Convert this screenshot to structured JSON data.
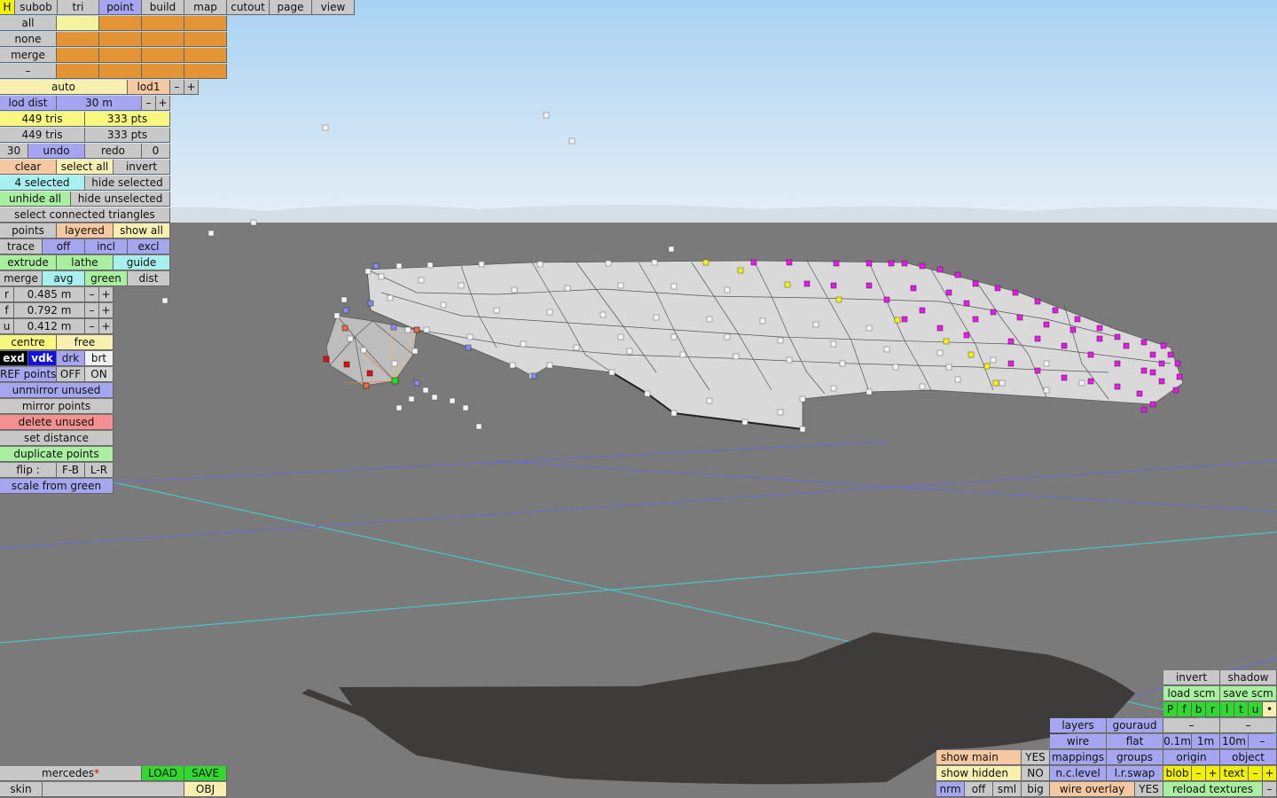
{
  "menu": {
    "h": "H",
    "tabs": [
      "subob",
      "tri",
      "point",
      "build",
      "map",
      "cutout",
      "page",
      "view"
    ],
    "active_tab": "point"
  },
  "select": {
    "all": "all",
    "none": "none",
    "merge": "merge",
    "minus": "–"
  },
  "lod": {
    "auto": "auto",
    "level": "lod1",
    "minus": "–",
    "plus": "+",
    "dist_label": "lod dist",
    "dist_value": "30 m",
    "tris1": "449 tris",
    "pts1": "333 pts",
    "tris2": "449 tris",
    "pts2": "333 pts"
  },
  "undo": {
    "count": "30",
    "undo": "undo",
    "redo": "redo",
    "redo_count": "0"
  },
  "selection": {
    "clear": "clear",
    "select_all": "select all",
    "invert": "invert",
    "selected": "4 selected",
    "hide_selected": "hide selected",
    "unhide_all": "unhide all",
    "hide_unselected": "hide unselected",
    "connected": "select connected triangles"
  },
  "mode": {
    "points": "points",
    "layered": "layered",
    "show_all": "show all"
  },
  "trace": {
    "trace": "trace",
    "off": "off",
    "incl": "incl",
    "excl": "excl"
  },
  "tools": {
    "extrude": "extrude",
    "lathe": "lathe",
    "guide": "guide",
    "merge": "merge",
    "avg": "avg",
    "green": "green",
    "dist": "dist"
  },
  "values": {
    "r_label": "r",
    "r_value": "0.485 m",
    "f_label": "f",
    "f_value": "0.792 m",
    "u_label": "u",
    "u_value": "0.412 m",
    "minus": "–",
    "plus": "+"
  },
  "pivot": {
    "centre": "centre",
    "free": "free"
  },
  "render_mode": {
    "exd": "exd",
    "vdk": "vdk",
    "drk": "drk",
    "brt": "brt"
  },
  "ref": {
    "label": "REF points",
    "off": "OFF",
    "on": "ON"
  },
  "actions": {
    "unmirror": "unmirror unused",
    "mirror": "mirror points",
    "delete": "delete unused",
    "set_distance": "set distance",
    "duplicate": "duplicate points",
    "flip": "flip :",
    "fb": "F-B",
    "lr": "L-R",
    "scale": "scale from green"
  },
  "file": {
    "name": "mercedes",
    "star": "*",
    "load": "LOAD",
    "save": "SAVE",
    "skin": "skin",
    "obj": "OBJ"
  },
  "display": {
    "show_main": "show main",
    "show_main_val": "YES",
    "show_hidden": "show hidden",
    "show_hidden_val": "NO",
    "nrm": "nrm",
    "off": "off",
    "sml": "sml",
    "big": "big",
    "layers": "layers",
    "gouraud": "gouraud",
    "wire": "wire",
    "flat": "flat",
    "mappings": "mappings",
    "groups": "groups",
    "nclevel": "n.c.level",
    "lrswap": "l.r.swap",
    "wire_overlay": "wire overlay",
    "wire_overlay_val": "YES"
  },
  "scene": {
    "invert": "invert",
    "shadow": "shadow",
    "load_scm": "load scm",
    "save_scm": "save scm",
    "letters": [
      "P",
      "f",
      "b",
      "r",
      "l",
      "t",
      "u"
    ],
    "dot": "•",
    "dash": "–",
    "grid": [
      "0.1m",
      "1m",
      "10m"
    ],
    "origin": "origin",
    "object": "object",
    "blob": "blob",
    "text": "text",
    "minus": "–",
    "plus": "+",
    "reload": "reload textures"
  }
}
